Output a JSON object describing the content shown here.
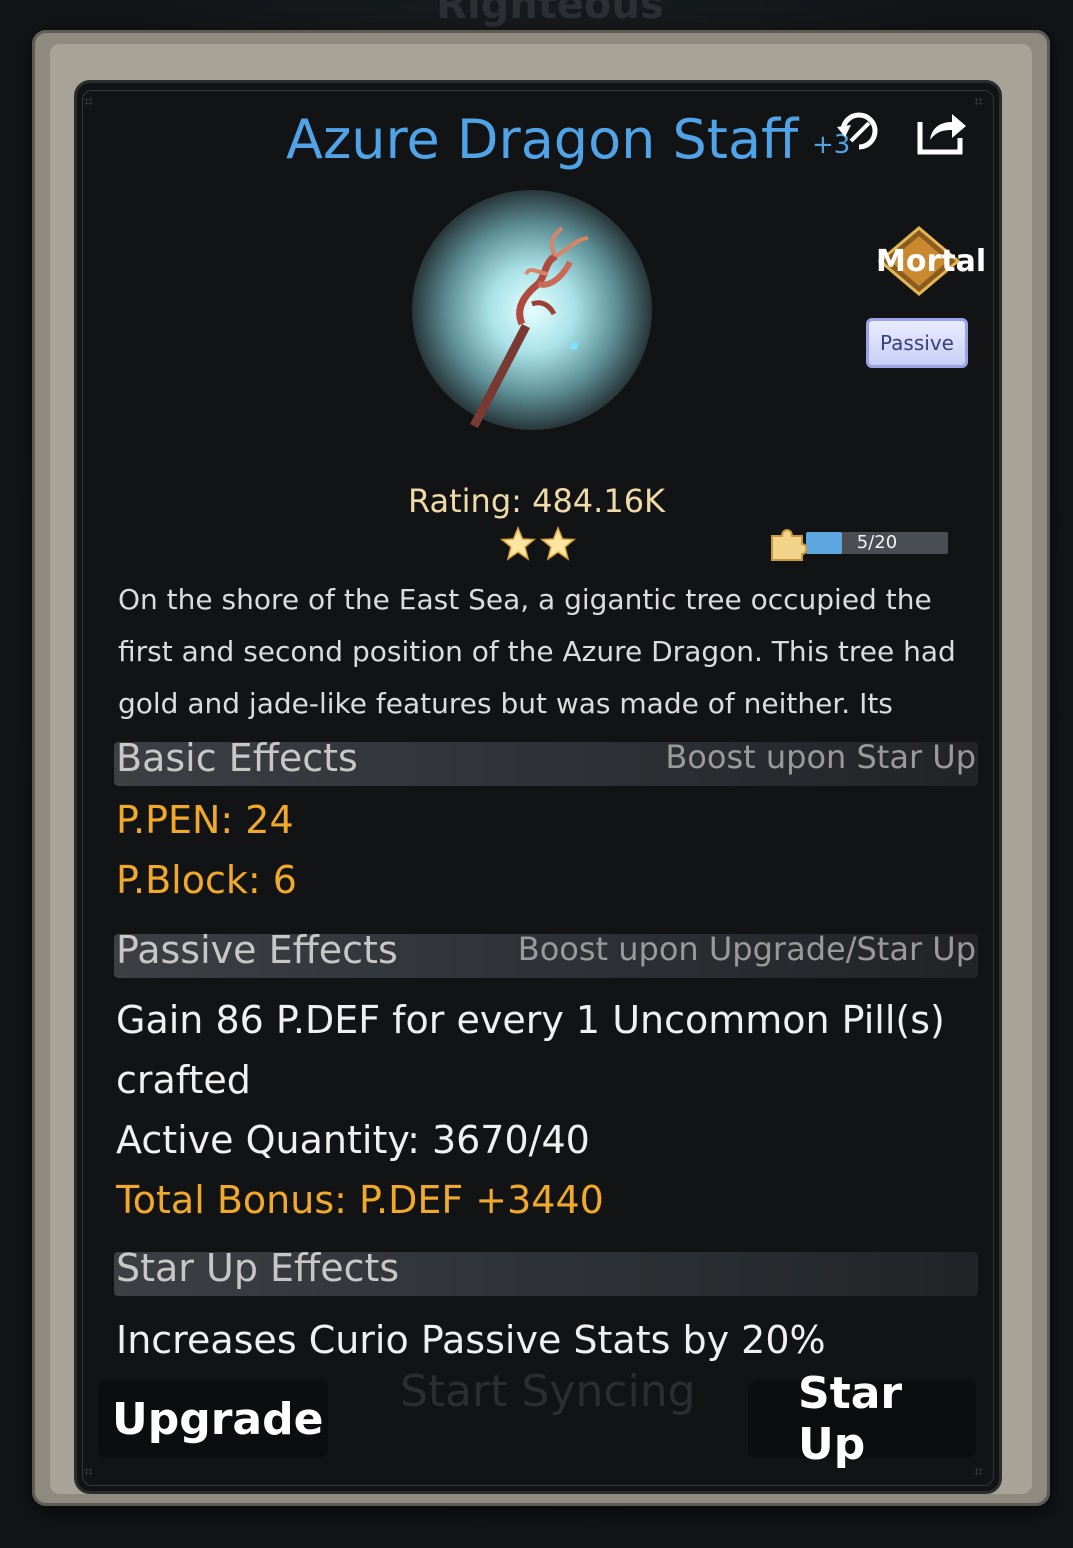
{
  "background": {
    "title": "Righteous Treasure",
    "ghost_button": "Start Syncing"
  },
  "item": {
    "name": "Azure Dragon Staff",
    "level_tag": "+3",
    "rarity_badge": "Mortal",
    "type_badge": "Passive",
    "rating": "Rating: 484.16K",
    "stars": 2,
    "shard_progress_text": "5/20",
    "shard_progress_fraction": 0.25,
    "description": "On the shore of the East Sea, a gigantic tree occupied the first and second position of the Azure Dragon. This tree had gold and jade-like features but was made of neither. Its whole"
  },
  "basic_effects": {
    "title": "Basic Effects",
    "hint": "Boost upon Star Up",
    "stats": [
      "P.PEN: 24",
      "P.Block: 6"
    ]
  },
  "passive_effects": {
    "title": "Passive Effects",
    "hint": "Boost upon Upgrade/Star Up",
    "line1": "Gain 86 P.DEF for every 1 Uncommon Pill(s)",
    "line2": "crafted",
    "active_quantity": "Active Quantity: 3670/40",
    "total_bonus": "Total Bonus: P.DEF +3440"
  },
  "star_up_effects": {
    "title": "Star Up Effects",
    "line": "Increases Curio Passive Stats by 20%"
  },
  "buttons": {
    "upgrade": "Upgrade",
    "star_up": "Star Up"
  },
  "icons": {
    "refresh": "refresh-icon",
    "share": "share-icon",
    "star": "star-icon",
    "shard": "puzzle-shard-icon"
  },
  "colors": {
    "title_blue": "#4fa3e6",
    "stat_orange": "#f1a92b",
    "rating_gold": "#f0d9a8",
    "progress_blue": "#5ea6e0"
  }
}
